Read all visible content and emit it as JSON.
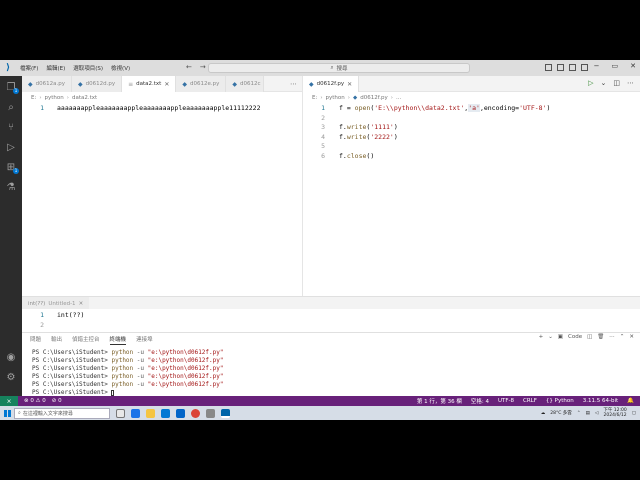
{
  "menu": [
    "檔案(F)",
    "編輯(E)",
    "選取項目(S)",
    "檢視(V)"
  ],
  "search": {
    "label": "搜尋",
    "icon": "search-icon"
  },
  "activity_badges": {
    "explorer": "1",
    "extensions": "1"
  },
  "left_group": {
    "tabs": [
      {
        "label": "d0612a.py",
        "kind": "py",
        "active": false
      },
      {
        "label": "d0612d.py",
        "kind": "py",
        "active": false
      },
      {
        "label": "data2.txt",
        "kind": "txt",
        "active": true
      },
      {
        "label": "d0612e.py",
        "kind": "py",
        "active": false
      },
      {
        "label": "d0612c",
        "kind": "py",
        "active": false
      }
    ],
    "breadcrumb": [
      "E:",
      "python",
      "data2.txt"
    ],
    "lines": [
      {
        "n": "1",
        "text": "aaaaaaappleaaaaaaappleaaaaaaappleaaaaaaapple11112222"
      }
    ]
  },
  "right_group": {
    "tab": {
      "label": "d0612f.py"
    },
    "breadcrumb": [
      "E:",
      "python",
      "d0612f.py",
      "..."
    ],
    "line_numbers": [
      "1",
      "2",
      "3",
      "4",
      "5",
      "6"
    ],
    "line1": {
      "var": "f",
      "eq": " = ",
      "fn": "open",
      "open_paren": "(",
      "path": "'E:\\\\python\\\\data2.txt'",
      "comma": ",",
      "mode": "'a'",
      "rest": ",encoding=",
      "enc": "'UTF-8'",
      "close": ")"
    },
    "line3": {
      "obj": "f.",
      "fn": "write",
      "arg": "'1111'"
    },
    "line4": {
      "obj": "f.",
      "fn": "write",
      "arg": "'2222'"
    },
    "line6": {
      "obj": "f.",
      "fn": "close",
      "arg": ""
    }
  },
  "bottom_editor": {
    "tab": "int(??)",
    "tab_suffix": "Untitled-1",
    "lines": [
      {
        "n": "1",
        "text": "int(??)"
      },
      {
        "n": "2",
        "text": ""
      }
    ]
  },
  "panel": {
    "tabs": [
      "問題",
      "輸出",
      "偵錯主控台",
      "終端機",
      "連接埠"
    ],
    "active_tab": "終端機",
    "code_label": "Code",
    "terminal": [
      {
        "prompt": "PS C:\\Users\\iStudent> ",
        "cmd": "python",
        "flag": " -u ",
        "arg": "\"e:\\python\\d0612f.py\""
      },
      {
        "prompt": "PS C:\\Users\\iStudent> ",
        "cmd": "python",
        "flag": " -u ",
        "arg": "\"e:\\python\\d0612f.py\""
      },
      {
        "prompt": "PS C:\\Users\\iStudent> ",
        "cmd": "python",
        "flag": " -u ",
        "arg": "\"e:\\python\\d0612f.py\""
      },
      {
        "prompt": "PS C:\\Users\\iStudent> ",
        "cmd": "python",
        "flag": " -u ",
        "arg": "\"e:\\python\\d0612f.py\""
      },
      {
        "prompt": "PS C:\\Users\\iStudent> ",
        "cmd": "python",
        "flag": " -u ",
        "arg": "\"e:\\python\\d0612f.py\""
      },
      {
        "prompt": "PS C:\\Users\\iStudent> ",
        "cmd": "",
        "flag": "",
        "arg": ""
      }
    ]
  },
  "statusbar": {
    "problems": "⊗ 0 ⚠ 0",
    "ports": "⊘ 0",
    "position": "第 1 行，第 36 欄",
    "spaces": "空格: 4",
    "encoding": "UTF-8",
    "eol": "CRLF",
    "language": "Python",
    "interpreter": "3.11.5 64-bit"
  },
  "taskbar": {
    "search_placeholder": "在這裡輸入文字來搜尋",
    "weather": "28°C 多雲",
    "time": "下午 12:00",
    "date": "2024/6/12"
  },
  "colors": {
    "statusbar": "#68217a",
    "remote": "#16825d",
    "activitybar": "#2c2c2c"
  }
}
